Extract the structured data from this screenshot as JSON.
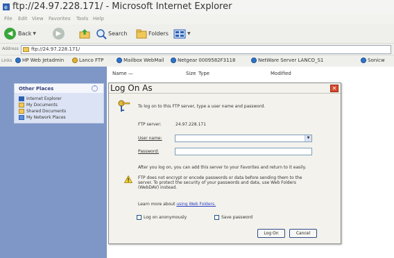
{
  "window": {
    "title": "ftp://24.97.228.171/ - Microsoft Internet Explorer"
  },
  "menu": [
    "File",
    "Edit",
    "View",
    "Favorites",
    "Tools",
    "Help"
  ],
  "toolbar": {
    "back_label": "Back",
    "search_label": "Search",
    "folders_label": "Folders"
  },
  "address": {
    "label": "Address",
    "value": "ftp://24.97.228.171/"
  },
  "links": {
    "label": "Links",
    "items": [
      "HP Web Jetadmin",
      "Lanco FTP",
      "Mailbox WebMail",
      "Netgear 0009582F3118",
      "NetWare Server LANCO_S1",
      "Sonicw"
    ]
  },
  "columns": {
    "name": "Name",
    "size": "Size",
    "type": "Type",
    "modified": "Modified"
  },
  "other_places": {
    "title": "Other Places",
    "items": [
      "Internet Explorer",
      "My Documents",
      "Shared Documents",
      "My Network Places"
    ]
  },
  "dialog": {
    "title": "Log On As",
    "intro": "To log on to this FTP server, type a user name and password.",
    "ftp_server_label": "FTP server:",
    "ftp_server_value": "24.97.228.171",
    "username_label": "User name:",
    "password_label": "Password:",
    "after_logon": "After you log on, you can add this server to your Favorites and return to it easily.",
    "warning_line1": "FTP does not encrypt or encode passwords or data before sending them to the",
    "warning_line2": "server.  To protect the security of your passwords and data, use Web Folders",
    "warning_line3": "(WebDAV) instead.",
    "learn_more_prefix": "Learn more about",
    "learn_more_link": "using Web Folders.",
    "anonymous_label": "Log on anonymously",
    "save_password_label": "Save password",
    "logon_button": "Log On",
    "cancel_button": "Cancel"
  },
  "colors": {
    "left_pane": "#7e97c7",
    "dialog_bg": "#f3f2ec",
    "close_red": "#d64b2e",
    "link_blue": "#2a3fc4"
  }
}
